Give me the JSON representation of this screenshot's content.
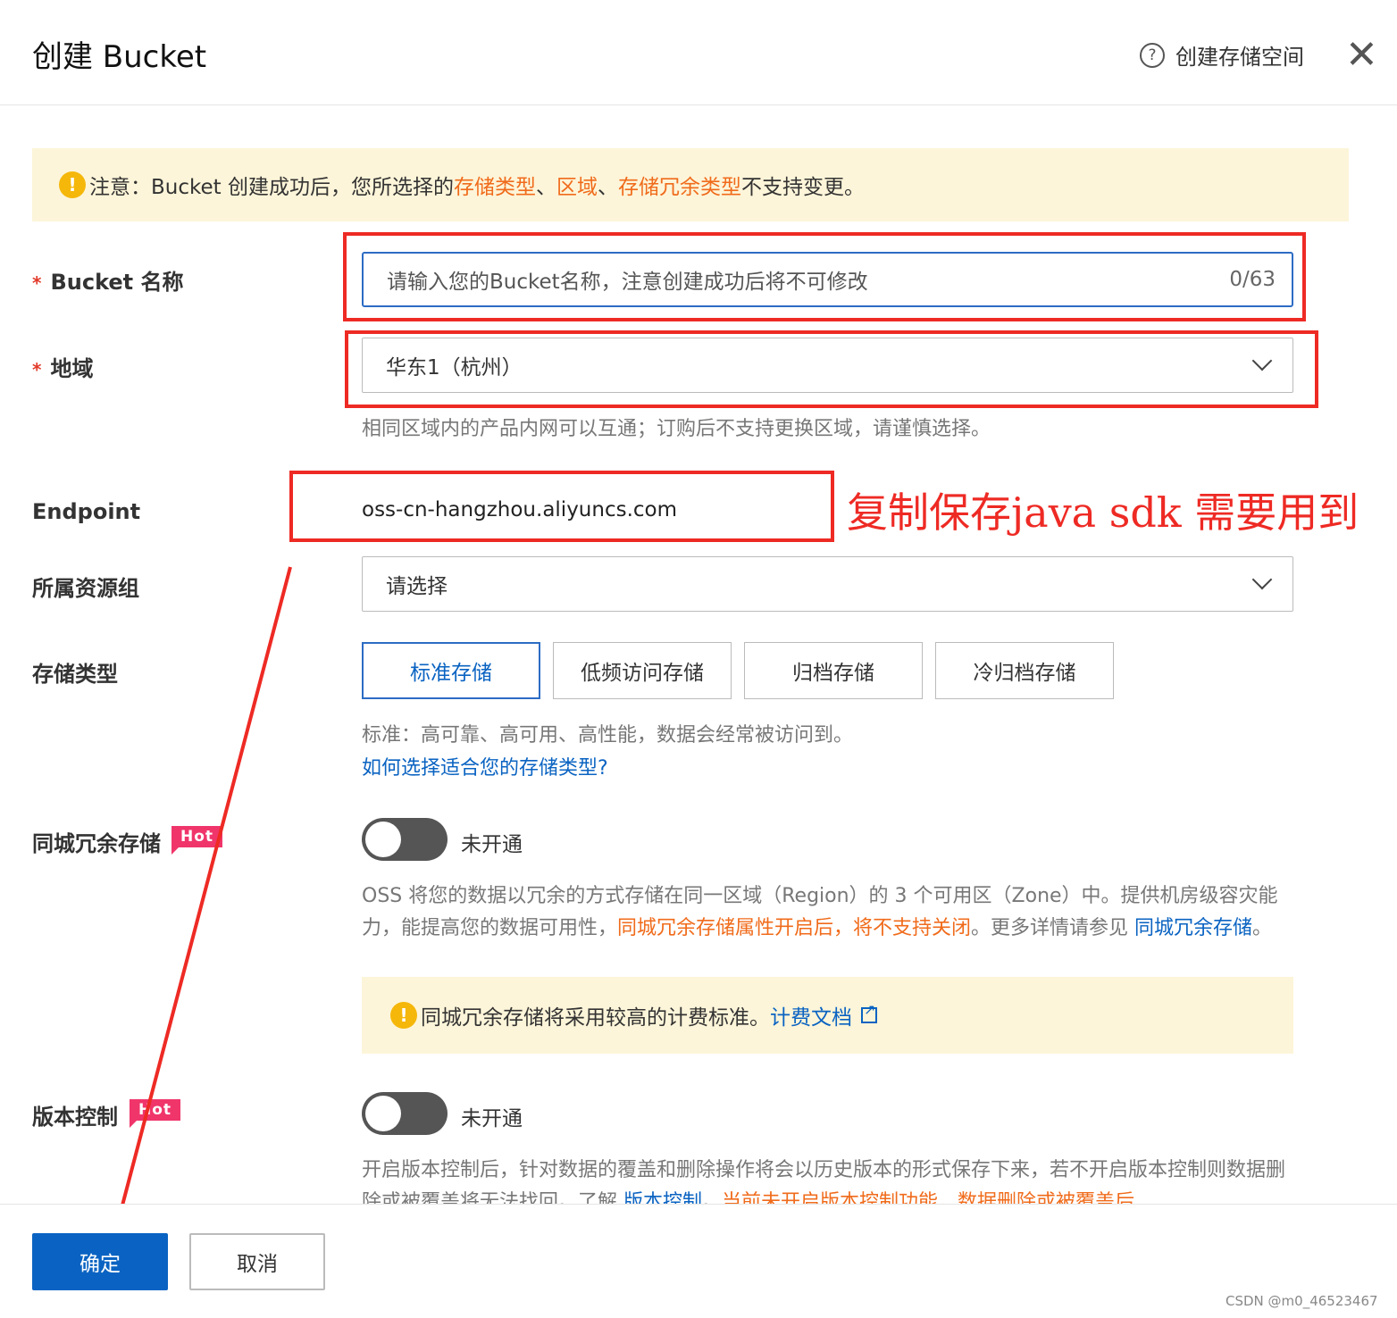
{
  "dialog": {
    "title": "创建 Bucket",
    "help_label": "创建存储空间",
    "help_icon": "?",
    "close_icon": "✕"
  },
  "notice": {
    "icon": "!",
    "prefix": "注意：Bucket 创建成功后，您所选择的 ",
    "item1": "存储类型",
    "sep1": "、",
    "item2": "区域",
    "sep2": "、",
    "item3": "存储冗余类型",
    "suffix": " 不支持变更。"
  },
  "form": {
    "bucket_name": {
      "required": "*",
      "label": "Bucket 名称",
      "placeholder": "请输入您的Bucket名称，注意创建成功后将不可修改",
      "counter": "0/63"
    },
    "region": {
      "required": "*",
      "label": "地域",
      "value": "华东1（杭州）",
      "hint": "相同区域内的产品内网可以互通；订购后不支持更换区域，请谨慎选择。"
    },
    "endpoint": {
      "label": "Endpoint",
      "value": "oss-cn-hangzhou.aliyuncs.com"
    },
    "resource_group": {
      "label": "所属资源组",
      "value": "请选择"
    },
    "storage_type": {
      "label": "存储类型",
      "options": [
        "标准存储",
        "低频访问存储",
        "归档存储",
        "冷归档存储"
      ],
      "selected": "标准存储",
      "hint": "标准：高可靠、高可用、高性能，数据会经常被访问到。",
      "link": "如何选择适合您的存储类型?"
    },
    "zrs": {
      "label": "同城冗余存储",
      "badge": "Hot",
      "toggle_label": "未开通",
      "desc1": "OSS 将您的数据以冗余的方式存储在同一区域（Region）的 3 个可用区（Zone）中。提供机房级容灾能力，能提高您的数据可用性，",
      "desc_warn": "同城冗余存储属性开启后，将不支持关闭",
      "desc2": "。更多详情请参见 ",
      "desc_link": "同城冗余存储",
      "desc3": "。",
      "warn_icon": "!",
      "warn_text": "同城冗余存储将采用较高的计费标准。",
      "warn_link": "计费文档"
    },
    "versioning": {
      "label": "版本控制",
      "badge": "Hot",
      "toggle_label": "未开通",
      "desc1": "开启版本控制后，针对数据的覆盖和删除操作将会以历史版本的形式保存下来，若不开启版本控制则数据删除或被覆盖将无法找回。了解 ",
      "desc_link": "版本控制",
      "desc2": "。",
      "desc_warn": "当前未开启版本控制功能，数据删除或被覆盖后"
    }
  },
  "annotation": {
    "text": "复制保存java sdk 需要用到",
    "color": "#ee2a24"
  },
  "footer": {
    "ok": "确定",
    "cancel": "取消",
    "watermark": "CSDN @m0_46523467"
  },
  "colors": {
    "primary": "#0a63c2",
    "warning_text": "#f06b1b",
    "notice_bg": "#fdf5d9",
    "hot_badge": "#f0356b"
  }
}
